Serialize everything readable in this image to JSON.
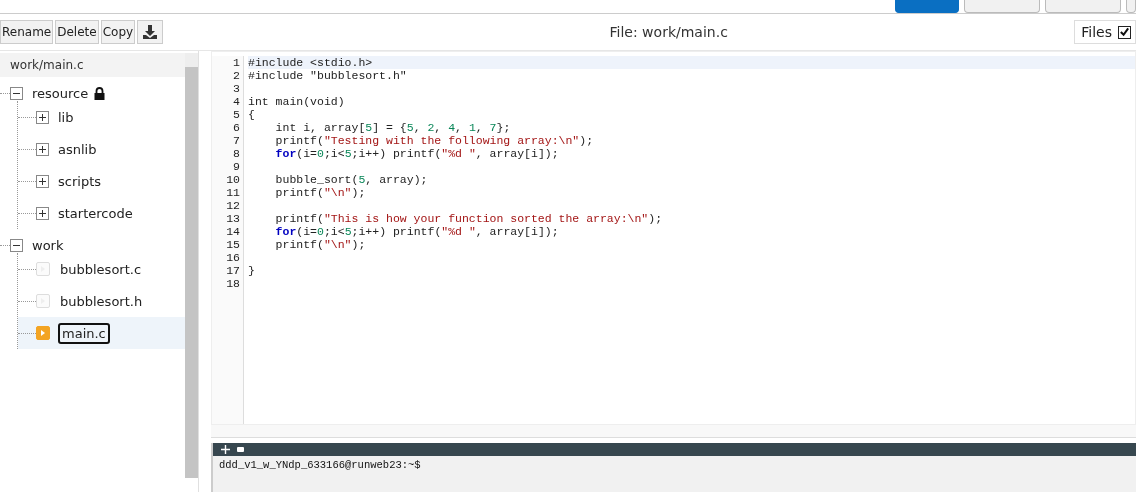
{
  "top_buttons": [
    {
      "kind": "primary"
    },
    {
      "kind": "plain"
    },
    {
      "kind": "plain"
    },
    {
      "kind": "plain"
    }
  ],
  "toolbar": {
    "buttons": [
      "Rename",
      "Delete",
      "Copy"
    ],
    "title": "File: work/main.c",
    "files_toggle": {
      "label": "Files",
      "checked": true
    }
  },
  "sidebar": {
    "path": "work/main.c",
    "tree": [
      {
        "label": "resource",
        "kind": "folder",
        "expanded": true,
        "locked": true,
        "children": [
          {
            "label": "lib",
            "kind": "folder",
            "expanded": false
          },
          {
            "label": "asnlib",
            "kind": "folder",
            "expanded": false
          },
          {
            "label": "scripts",
            "kind": "folder",
            "expanded": false
          },
          {
            "label": "startercode",
            "kind": "folder",
            "expanded": false
          }
        ]
      },
      {
        "label": "work",
        "kind": "folder",
        "expanded": true,
        "children": [
          {
            "label": "bubblesort.c",
            "kind": "file",
            "selected": false
          },
          {
            "label": "bubblesort.h",
            "kind": "file",
            "selected": false
          },
          {
            "label": "main.c",
            "kind": "file",
            "selected": true
          }
        ]
      }
    ]
  },
  "editor": {
    "lines": [
      {
        "number": "1",
        "current": true,
        "indent": false,
        "tokens": [
          {
            "kind": "plain",
            "text": "#include <stdio.h>"
          }
        ]
      },
      {
        "number": "2",
        "current": false,
        "indent": false,
        "tokens": [
          {
            "kind": "plain",
            "text": "#include \"bubblesort.h\""
          }
        ]
      },
      {
        "number": "3",
        "current": false
      },
      {
        "number": "4",
        "current": false,
        "indent": false,
        "tokens": [
          {
            "kind": "plain",
            "text": "int main(void)"
          }
        ]
      },
      {
        "number": "5",
        "current": false,
        "indent": false,
        "tokens": [
          {
            "kind": "plain",
            "text": "{"
          }
        ]
      },
      {
        "number": "6",
        "current": false,
        "indent": true,
        "tokens": [
          {
            "kind": "plain",
            "text": "int i, array["
          },
          {
            "kind": "number",
            "text": "5"
          },
          {
            "kind": "plain",
            "text": "] = {"
          },
          {
            "kind": "number",
            "text": "5"
          },
          {
            "kind": "plain",
            "text": ", "
          },
          {
            "kind": "number",
            "text": "2"
          },
          {
            "kind": "plain",
            "text": ", "
          },
          {
            "kind": "number",
            "text": "4"
          },
          {
            "kind": "plain",
            "text": ", "
          },
          {
            "kind": "number",
            "text": "1"
          },
          {
            "kind": "plain",
            "text": ", "
          },
          {
            "kind": "number",
            "text": "7"
          },
          {
            "kind": "plain",
            "text": "};"
          }
        ]
      },
      {
        "number": "7",
        "current": false,
        "indent": true,
        "tokens": [
          {
            "kind": "plain",
            "text": "printf("
          },
          {
            "kind": "string",
            "text": "\"Testing with the following array:\\n\""
          },
          {
            "kind": "plain",
            "text": ");"
          }
        ]
      },
      {
        "number": "8",
        "current": false,
        "indent": true,
        "tokens": [
          {
            "kind": "keyword",
            "text": "for"
          },
          {
            "kind": "plain",
            "text": "(i="
          },
          {
            "kind": "number",
            "text": "0"
          },
          {
            "kind": "plain",
            "text": ";i<"
          },
          {
            "kind": "number",
            "text": "5"
          },
          {
            "kind": "plain",
            "text": ";i++) printf("
          },
          {
            "kind": "string",
            "text": "\"%d \""
          },
          {
            "kind": "plain",
            "text": ", array[i]);"
          }
        ]
      },
      {
        "number": "9",
        "current": false
      },
      {
        "number": "10",
        "current": false,
        "indent": true,
        "tokens": [
          {
            "kind": "plain",
            "text": "bubble_sort("
          },
          {
            "kind": "number",
            "text": "5"
          },
          {
            "kind": "plain",
            "text": ", array);"
          }
        ]
      },
      {
        "number": "11",
        "current": false,
        "indent": true,
        "tokens": [
          {
            "kind": "plain",
            "text": "printf("
          },
          {
            "kind": "string",
            "text": "\"\\n\""
          },
          {
            "kind": "plain",
            "text": ");"
          }
        ]
      },
      {
        "number": "12",
        "current": false
      },
      {
        "number": "13",
        "current": false,
        "indent": true,
        "tokens": [
          {
            "kind": "plain",
            "text": "printf("
          },
          {
            "kind": "string",
            "text": "\"This is how your function sorted the array:\\n\""
          },
          {
            "kind": "plain",
            "text": ");"
          }
        ]
      },
      {
        "number": "14",
        "current": false,
        "indent": true,
        "tokens": [
          {
            "kind": "keyword",
            "text": "for"
          },
          {
            "kind": "plain",
            "text": "(i="
          },
          {
            "kind": "number",
            "text": "0"
          },
          {
            "kind": "plain",
            "text": ";i<"
          },
          {
            "kind": "number",
            "text": "5"
          },
          {
            "kind": "plain",
            "text": ";i++) printf("
          },
          {
            "kind": "string",
            "text": "\"%d \""
          },
          {
            "kind": "plain",
            "text": ", array[i]);"
          }
        ]
      },
      {
        "number": "15",
        "current": false,
        "indent": true,
        "tokens": [
          {
            "kind": "plain",
            "text": "printf("
          },
          {
            "kind": "string",
            "text": "\"\\n\""
          },
          {
            "kind": "plain",
            "text": ");"
          }
        ]
      },
      {
        "number": "16",
        "current": false
      },
      {
        "number": "17",
        "current": false,
        "indent": false,
        "tokens": [
          {
            "kind": "plain",
            "text": "}"
          }
        ]
      },
      {
        "number": "18",
        "current": false
      }
    ]
  },
  "terminal": {
    "prompt": "ddd_v1_w_YNdp_633166@runweb23:~$"
  }
}
